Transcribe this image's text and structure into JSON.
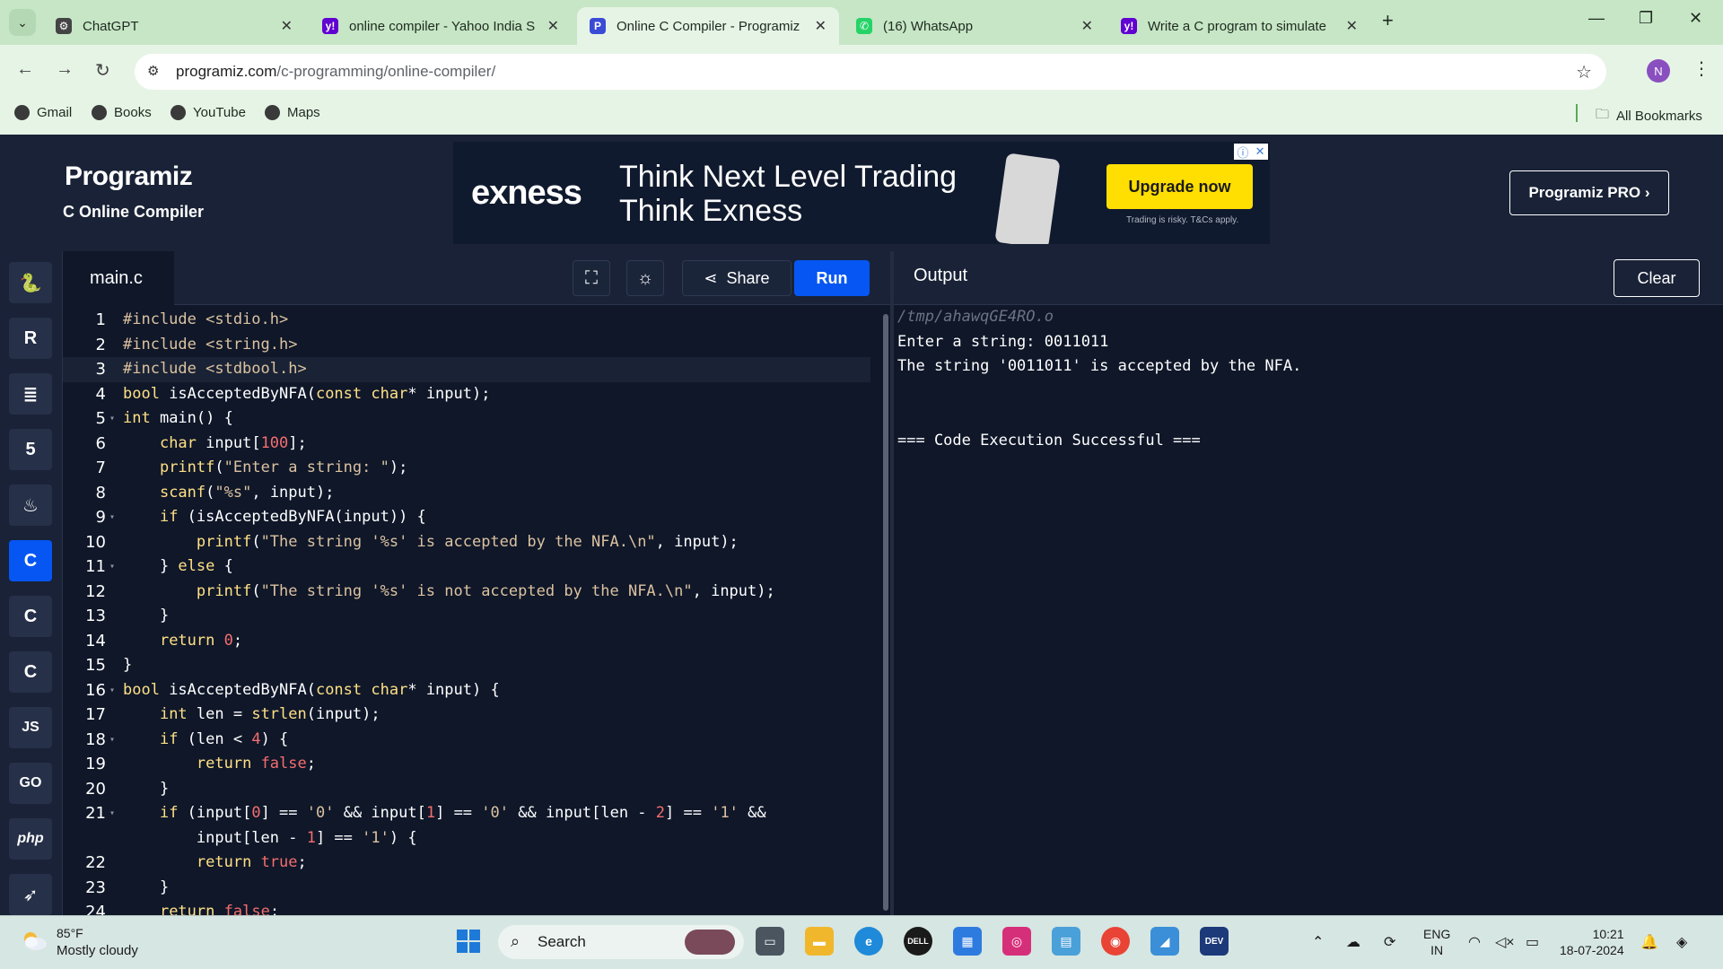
{
  "browser": {
    "tabs": [
      {
        "title": "ChatGPT",
        "favicon": "chatgpt-icon",
        "active": false
      },
      {
        "title": "online compiler - Yahoo India S",
        "favicon": "yahoo-icon",
        "active": false
      },
      {
        "title": "Online C Compiler - Programiz",
        "favicon": "programiz-icon",
        "active": true
      },
      {
        "title": "(16) WhatsApp",
        "favicon": "whatsapp-icon",
        "active": false
      },
      {
        "title": "Write a C program to simulate",
        "favicon": "yahoo-icon",
        "active": false
      }
    ],
    "url_host": "programiz.com",
    "url_path": "/c-programming/online-compiler/",
    "profile_initial": "N",
    "bookmarks": [
      "Gmail",
      "Books",
      "YouTube",
      "Maps"
    ],
    "all_bookmarks": "All Bookmarks"
  },
  "header": {
    "logo": "Programiz",
    "subtitle": "C Online Compiler",
    "pro_button": "Programiz PRO ›"
  },
  "ad": {
    "brand": "exness",
    "headline1": "Think Next Level Trading",
    "headline2": "Think Exness",
    "cta": "Upgrade now",
    "disclaimer": "Trading is risky. T&Cs apply."
  },
  "sidebar": {
    "languages": [
      "python",
      "r",
      "sql",
      "html",
      "java",
      "c",
      "c++",
      "c#",
      "js",
      "go",
      "php",
      "swift"
    ],
    "active": "c",
    "labels": {
      "js": "JS",
      "go": "GO",
      "php": "php"
    }
  },
  "editor": {
    "file_name": "main.c",
    "share_label": "Share",
    "run_label": "Run",
    "lines": [
      {
        "n": "1",
        "fold": false,
        "html": "<span class=\"pre\">#include &lt;stdio.h&gt;</span>"
      },
      {
        "n": "2",
        "fold": false,
        "html": "<span class=\"pre\">#include &lt;string.h&gt;</span>"
      },
      {
        "n": "3",
        "fold": false,
        "html": "<span class=\"pre\">#include &lt;stdbool.h&gt;</span>",
        "highlight": true
      },
      {
        "n": "4",
        "fold": false,
        "html": "<span class=\"kw\">bool</span> isAcceptedByNFA(<span class=\"kw\">const</span> <span class=\"kw\">char</span>* input);"
      },
      {
        "n": "5",
        "fold": true,
        "html": "<span class=\"kw\">int</span> main() {"
      },
      {
        "n": "6",
        "fold": false,
        "html": "    <span class=\"kw\">char</span> input[<span class=\"num\">100</span>];"
      },
      {
        "n": "7",
        "fold": false,
        "html": "    <span class=\"fn\">printf</span>(<span class=\"str\">\"Enter a string: \"</span>);"
      },
      {
        "n": "8",
        "fold": false,
        "html": "    <span class=\"fn\">scanf</span>(<span class=\"str\">\"%s\"</span>, input);"
      },
      {
        "n": "9",
        "fold": true,
        "html": "    <span class=\"kw\">if</span> (isAcceptedByNFA(input)) {"
      },
      {
        "n": "10",
        "fold": false,
        "html": "        <span class=\"fn\">printf</span>(<span class=\"str\">\"The string '%s' is accepted by the NFA.\\n\"</span>, input);"
      },
      {
        "n": "11",
        "fold": true,
        "html": "    } <span class=\"kw\">else</span> {"
      },
      {
        "n": "12",
        "fold": false,
        "html": "        <span class=\"fn\">printf</span>(<span class=\"str\">\"The string '%s' is not accepted by the NFA.\\n\"</span>, input);"
      },
      {
        "n": "13",
        "fold": false,
        "html": "    }"
      },
      {
        "n": "14",
        "fold": false,
        "html": "    <span class=\"kw\">return</span> <span class=\"num\">0</span>;"
      },
      {
        "n": "15",
        "fold": false,
        "html": "}"
      },
      {
        "n": "16",
        "fold": true,
        "html": "<span class=\"kw\">bool</span> isAcceptedByNFA(<span class=\"kw\">const</span> <span class=\"kw\">char</span>* input) {"
      },
      {
        "n": "17",
        "fold": false,
        "html": "    <span class=\"kw\">int</span> len = <span class=\"fn\">strlen</span>(input);"
      },
      {
        "n": "18",
        "fold": true,
        "html": "    <span class=\"kw\">if</span> (len &lt; <span class=\"num\">4</span>) {"
      },
      {
        "n": "19",
        "fold": false,
        "html": "        <span class=\"kw\">return</span> <span class=\"num\">false</span>;"
      },
      {
        "n": "20",
        "fold": false,
        "html": "    }"
      },
      {
        "n": "21",
        "fold": true,
        "html": "    <span class=\"kw\">if</span> (input[<span class=\"num\">0</span>] == <span class=\"str\">'0'</span> &amp;&amp; input[<span class=\"num\">1</span>] == <span class=\"str\">'0'</span> &amp;&amp; input[len - <span class=\"num\">2</span>] == <span class=\"str\">'1'</span> &amp;&amp;"
      },
      {
        "n": "",
        "fold": false,
        "html": "        input[len - <span class=\"num\">1</span>] == <span class=\"str\">'1'</span>) {"
      },
      {
        "n": "22",
        "fold": false,
        "html": "        <span class=\"kw\">return</span> <span class=\"num\">true</span>;"
      },
      {
        "n": "23",
        "fold": false,
        "html": "    }"
      },
      {
        "n": "24",
        "fold": false,
        "html": "    <span class=\"kw\">return</span> <span class=\"num\">false</span>;"
      }
    ]
  },
  "output": {
    "title": "Output",
    "clear_label": "Clear",
    "lines": [
      {
        "text": "/tmp/ahawqGE4RO.o",
        "kind": "path"
      },
      {
        "text": "Enter a string: 0011011",
        "kind": "normal"
      },
      {
        "text": "The string '0011011' is accepted by the NFA.",
        "kind": "normal"
      },
      {
        "text": "",
        "kind": "normal"
      },
      {
        "text": "",
        "kind": "normal"
      },
      {
        "text": "=== Code Execution Successful ===",
        "kind": "normal"
      }
    ]
  },
  "taskbar": {
    "temperature": "85°F",
    "weather": "Mostly cloudy",
    "search_label": "Search",
    "lang_top": "ENG",
    "lang_bottom": "IN",
    "time": "10:21",
    "date": "18-07-2024"
  }
}
